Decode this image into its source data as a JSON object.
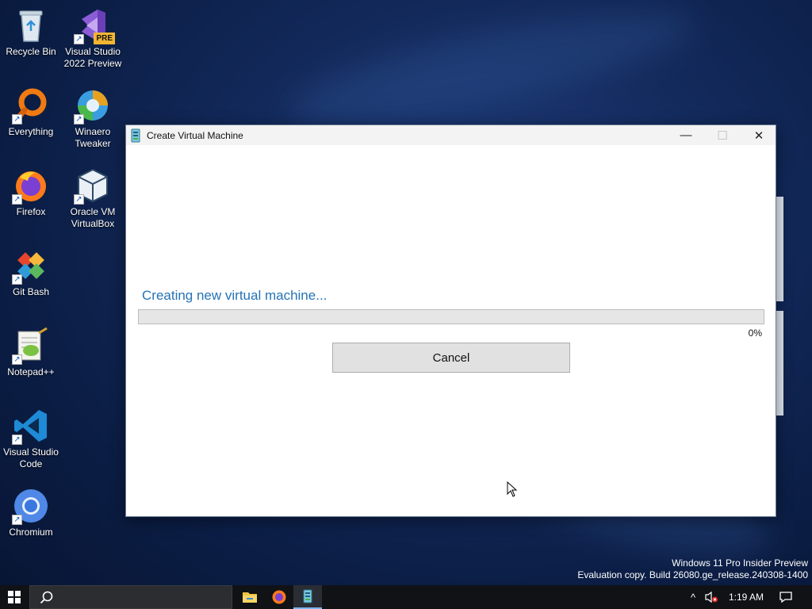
{
  "desktop": {
    "icons": [
      {
        "label": "Recycle Bin",
        "icon": "recycle-bin-icon"
      },
      {
        "label": "Visual Studio 2022 Preview",
        "icon": "visual-studio-icon",
        "badge": "PRE"
      },
      {
        "label": "Everything",
        "icon": "everything-search-icon"
      },
      {
        "label": "Winaero Tweaker",
        "icon": "winaero-tweaker-icon"
      },
      {
        "label": "Firefox",
        "icon": "firefox-icon"
      },
      {
        "label": "Oracle VM VirtualBox",
        "icon": "virtualbox-icon"
      },
      {
        "label": "Git Bash",
        "icon": "git-bash-icon"
      },
      {
        "label": "Notepad++",
        "icon": "notepad-plus-plus-icon"
      },
      {
        "label": "Visual Studio Code",
        "icon": "vscode-icon"
      },
      {
        "label": "Chromium",
        "icon": "chromium-icon"
      }
    ],
    "shortcut_glyph": "↗"
  },
  "dialog": {
    "title": "Create Virtual Machine",
    "minimize_glyph": "—",
    "maximize_glyph": "☐",
    "close_glyph": "✕",
    "status": "Creating new virtual machine...",
    "progress_percent": 0,
    "progress_label": "0%",
    "cancel_label": "Cancel"
  },
  "watermark": {
    "line1": "Windows 11 Pro Insider Preview",
    "line2": "Evaluation copy. Build 26080.ge_release.240308-1400"
  },
  "taskbar": {
    "apps": [
      {
        "name": "File Explorer",
        "icon": "file-explorer-icon"
      },
      {
        "name": "Firefox",
        "icon": "firefox-icon"
      },
      {
        "name": "Hyper-V Quick Create",
        "icon": "hyperv-icon",
        "active": true
      }
    ],
    "tray": {
      "chevron": "^",
      "time": "1:19 AM"
    }
  },
  "colors": {
    "accent": "#2573b7",
    "taskbar": "#101216",
    "progress_fill": "#06b025"
  }
}
